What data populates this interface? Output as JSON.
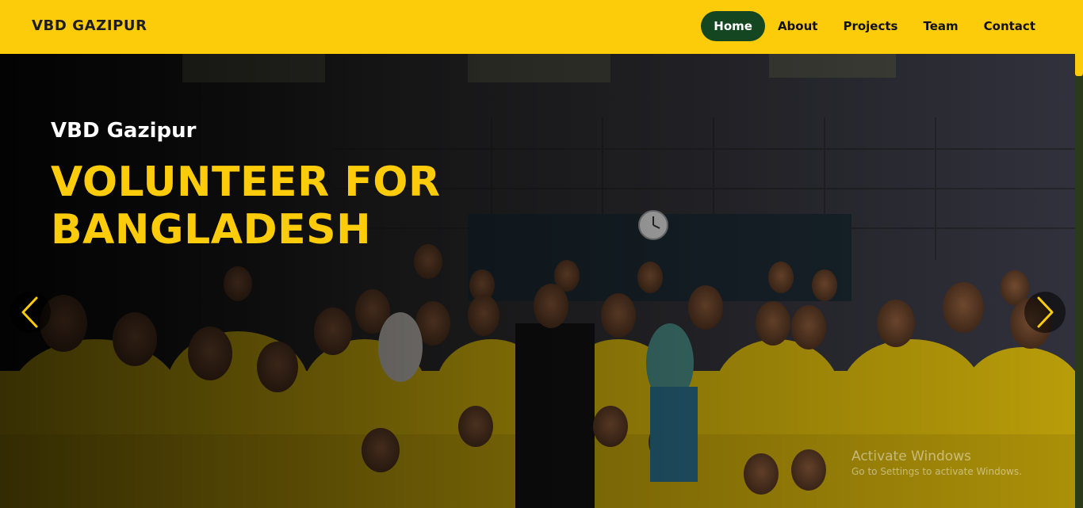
{
  "navbar": {
    "brand": "VBD GAZIPUR",
    "items": [
      {
        "label": "Home",
        "active": true
      },
      {
        "label": "About",
        "active": false
      },
      {
        "label": "Projects",
        "active": false
      },
      {
        "label": "Team",
        "active": false
      },
      {
        "label": "Contact",
        "active": false
      }
    ]
  },
  "hero": {
    "subtitle": "VBD Gazipur",
    "title": "VOLUNTEER FOR BANGLADESH",
    "prev_icon": "chevron-left-icon",
    "next_icon": "chevron-right-icon"
  },
  "watermark": {
    "line1": "Activate Windows",
    "line2": "Go to Settings to activate Windows."
  },
  "colors": {
    "accent": "#fccc0a",
    "active_nav": "#144721",
    "shirts": "#e6c20c"
  }
}
